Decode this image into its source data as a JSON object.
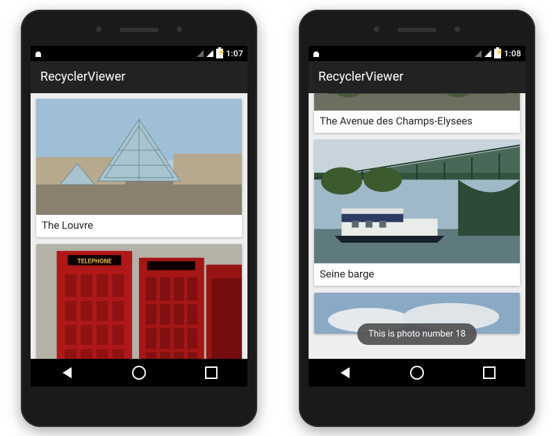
{
  "phones": [
    {
      "status": {
        "time": "1:07"
      },
      "appbar": {
        "title": "RecyclerViewer"
      },
      "cards": [
        {
          "caption": "The Louvre"
        }
      ],
      "toast": null
    },
    {
      "status": {
        "time": "1:08"
      },
      "appbar": {
        "title": "RecyclerViewer"
      },
      "cards": [
        {
          "caption": "The Avenue des Champs-Elysees"
        },
        {
          "caption": "Seine barge"
        }
      ],
      "toast": "This is photo number 18"
    }
  ]
}
